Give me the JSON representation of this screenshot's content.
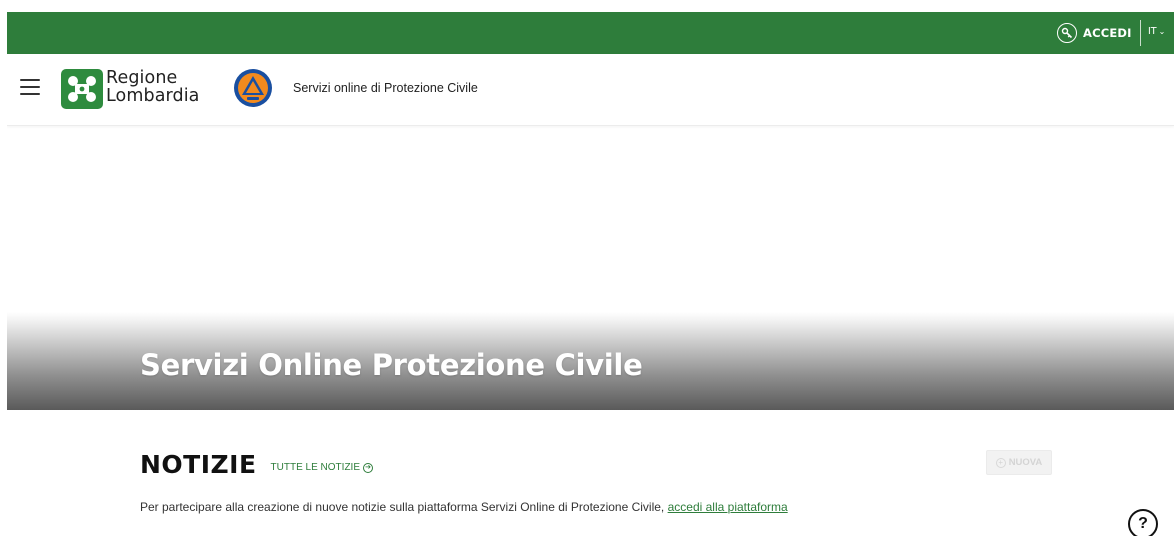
{
  "topbar": {
    "login_label": "ACCEDI",
    "login_icon": "key-icon",
    "language": "IT",
    "language_icon": "chevron-down-icon",
    "bg_color": "#2e7d3b"
  },
  "header": {
    "menu_icon": "hamburger-menu-icon",
    "logo_line1": "Regione",
    "logo_line2": "Lombardia",
    "secondary_logo": "protezione-civile-logo",
    "service_title": "Servizi online di Protezione Civile"
  },
  "hero": {
    "title": "Servizi Online Protezione Civile"
  },
  "news": {
    "title": "NOTIZIE",
    "all_news_label": "TUTTE LE NOTIZIE",
    "all_news_icon": "arrow-circle-right-icon",
    "new_button_label": "NUOVA",
    "new_button_icon": "plus-circle-icon",
    "description": "Per partecipare alla creazione di nuove notizie sulla piattaforma Servizi Online di Protezione Civile, ",
    "login_link": "accedi alla piattaforma"
  },
  "help": {
    "label": "?",
    "icon": "help-icon"
  },
  "colors": {
    "brand_green": "#2e7d3b",
    "text": "#222222"
  }
}
